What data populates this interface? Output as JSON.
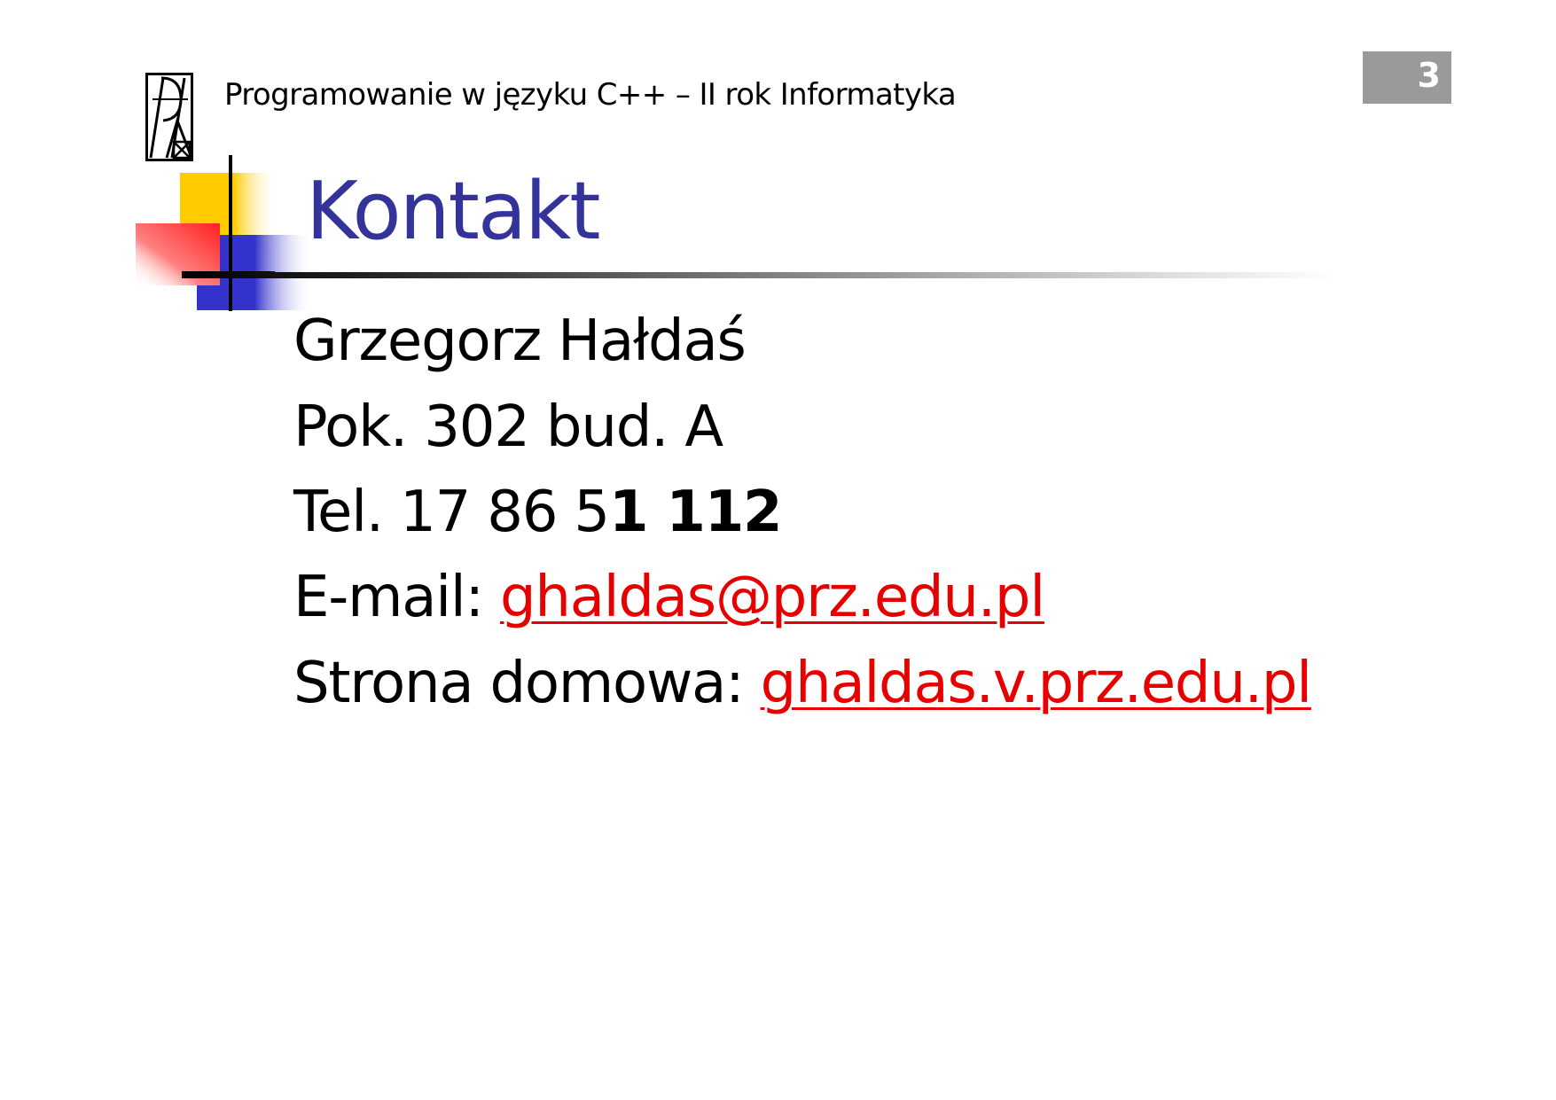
{
  "header": {
    "title": "Programowanie w języku C++ – II rok Informatyka",
    "logo": "prz-university-logo-icon"
  },
  "page_number": "3",
  "slide": {
    "title": "Kontakt",
    "name": "Grzegorz Hałdaś",
    "room": "Pok. 302 bud. A",
    "phone_prefix": "Tel. 17 86 5",
    "phone_bold": "1 112",
    "email_label": "E-mail: ",
    "email": "ghaldas@prz.edu.pl",
    "homepage_label": "Strona domowa: ",
    "homepage": "ghaldas.v.prz.edu.pl"
  },
  "colors": {
    "title": "#333399",
    "link": "#e60000",
    "badge": "#9a9a9a",
    "deco_yellow": "#ffcc00",
    "deco_red": "#ff3333",
    "deco_blue": "#3333cc"
  }
}
